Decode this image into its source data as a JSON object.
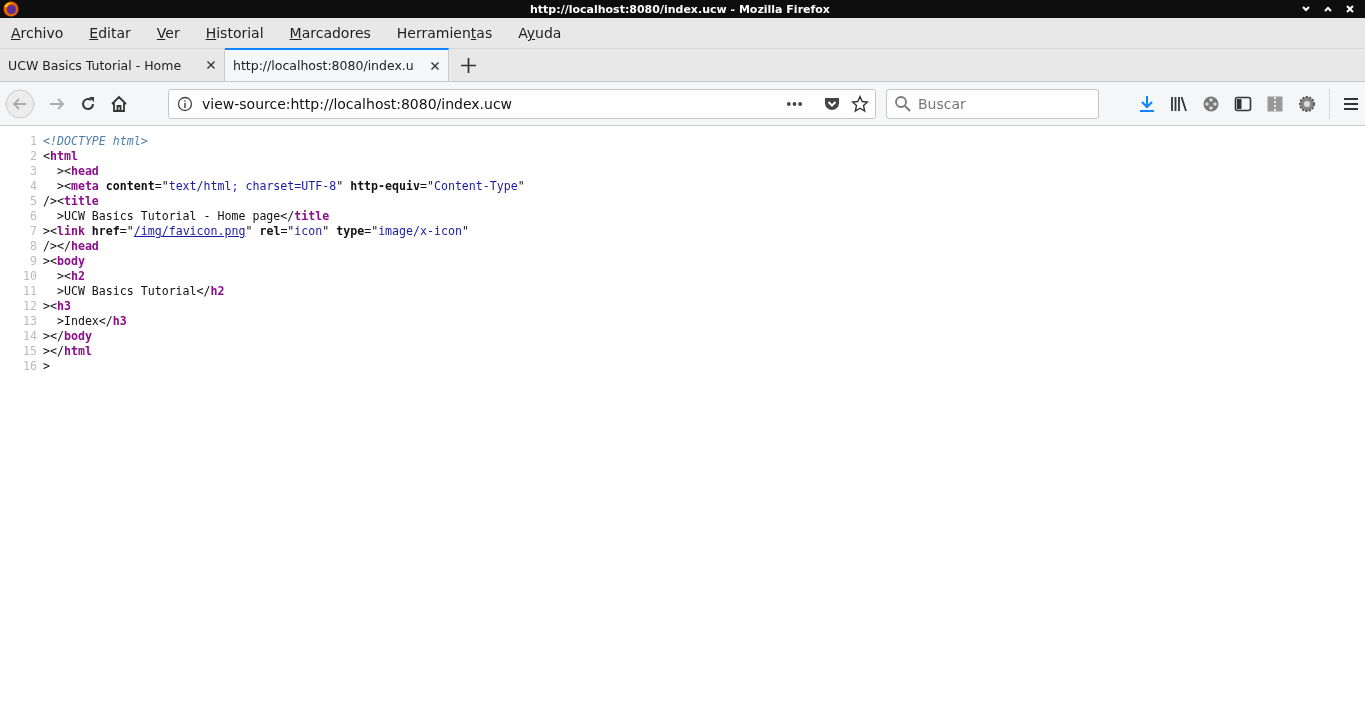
{
  "window": {
    "title": "http://localhost:8080/index.ucw - Mozilla Firefox"
  },
  "menu": [
    {
      "key": "A",
      "after": "rchivo"
    },
    {
      "key": "E",
      "after": "ditar"
    },
    {
      "key": "V",
      "after": "er"
    },
    {
      "key": "H",
      "after": "istorial"
    },
    {
      "key": "M",
      "after": "arcadores"
    },
    {
      "before": "Herramien",
      "key": "t",
      "after": "as"
    },
    {
      "before": "A",
      "key": "y",
      "after": "uda"
    }
  ],
  "tabs": [
    {
      "label": "UCW Basics Tutorial - Home",
      "selected": false
    },
    {
      "label": "http://localhost:8080/index.u",
      "selected": true
    }
  ],
  "address": {
    "value": "view-source:http://localhost:8080/index.ucw"
  },
  "search": {
    "placeholder": "Buscar"
  },
  "source": [
    {
      "number": "1",
      "tokens": [
        {
          "kind": "doctype",
          "text": "<!DOCTYPE html>"
        }
      ]
    },
    {
      "number": "2",
      "tokens": [
        {
          "kind": "punct",
          "text": "<"
        },
        {
          "kind": "tag",
          "text": "html"
        }
      ]
    },
    {
      "number": "3",
      "tokens": [
        {
          "kind": "punct",
          "text": "  ><"
        },
        {
          "kind": "tag",
          "text": "head"
        }
      ]
    },
    {
      "number": "4",
      "tokens": [
        {
          "kind": "punct",
          "text": "  ><"
        },
        {
          "kind": "tag",
          "text": "meta"
        },
        {
          "kind": "attr",
          "text": " content"
        },
        {
          "kind": "punct",
          "text": "=\""
        },
        {
          "kind": "value",
          "text": "text/html; charset=UTF-8"
        },
        {
          "kind": "punct",
          "text": "\" "
        },
        {
          "kind": "attr",
          "text": "http-equiv"
        },
        {
          "kind": "punct",
          "text": "=\""
        },
        {
          "kind": "value",
          "text": "Content-Type"
        },
        {
          "kind": "punct",
          "text": "\""
        }
      ]
    },
    {
      "number": "5",
      "tokens": [
        {
          "kind": "punct",
          "text": "/><"
        },
        {
          "kind": "tag",
          "text": "title"
        }
      ]
    },
    {
      "number": "6",
      "tokens": [
        {
          "kind": "punct",
          "text": "  >UCW Basics Tutorial - Home page</"
        },
        {
          "kind": "tag",
          "text": "title"
        }
      ]
    },
    {
      "number": "7",
      "tokens": [
        {
          "kind": "punct",
          "text": "><"
        },
        {
          "kind": "tag",
          "text": "link"
        },
        {
          "kind": "attr",
          "text": " href"
        },
        {
          "kind": "punct",
          "text": "=\""
        },
        {
          "kind": "link",
          "text": "/img/favicon.png"
        },
        {
          "kind": "punct",
          "text": "\" "
        },
        {
          "kind": "attr",
          "text": "rel"
        },
        {
          "kind": "punct",
          "text": "=\""
        },
        {
          "kind": "value",
          "text": "icon"
        },
        {
          "kind": "punct",
          "text": "\" "
        },
        {
          "kind": "attr",
          "text": "type"
        },
        {
          "kind": "punct",
          "text": "=\""
        },
        {
          "kind": "value",
          "text": "image/x-icon"
        },
        {
          "kind": "punct",
          "text": "\""
        }
      ]
    },
    {
      "number": "8",
      "tokens": [
        {
          "kind": "punct",
          "text": "/></"
        },
        {
          "kind": "tag",
          "text": "head"
        }
      ]
    },
    {
      "number": "9",
      "tokens": [
        {
          "kind": "punct",
          "text": "><"
        },
        {
          "kind": "tag",
          "text": "body"
        }
      ]
    },
    {
      "number": "10",
      "tokens": [
        {
          "kind": "punct",
          "text": "  ><"
        },
        {
          "kind": "tag",
          "text": "h2"
        }
      ]
    },
    {
      "number": "11",
      "tokens": [
        {
          "kind": "punct",
          "text": "  >UCW Basics Tutorial</"
        },
        {
          "kind": "tag",
          "text": "h2"
        }
      ]
    },
    {
      "number": "12",
      "tokens": [
        {
          "kind": "punct",
          "text": "><"
        },
        {
          "kind": "tag",
          "text": "h3"
        }
      ]
    },
    {
      "number": "13",
      "tokens": [
        {
          "kind": "punct",
          "text": "  >Index</"
        },
        {
          "kind": "tag",
          "text": "h3"
        }
      ]
    },
    {
      "number": "14",
      "tokens": [
        {
          "kind": "punct",
          "text": "></"
        },
        {
          "kind": "tag",
          "text": "body"
        }
      ]
    },
    {
      "number": "15",
      "tokens": [
        {
          "kind": "punct",
          "text": "></"
        },
        {
          "kind": "tag",
          "text": "html"
        }
      ]
    },
    {
      "number": "16",
      "tokens": [
        {
          "kind": "punct",
          "text": ">"
        }
      ]
    }
  ]
}
